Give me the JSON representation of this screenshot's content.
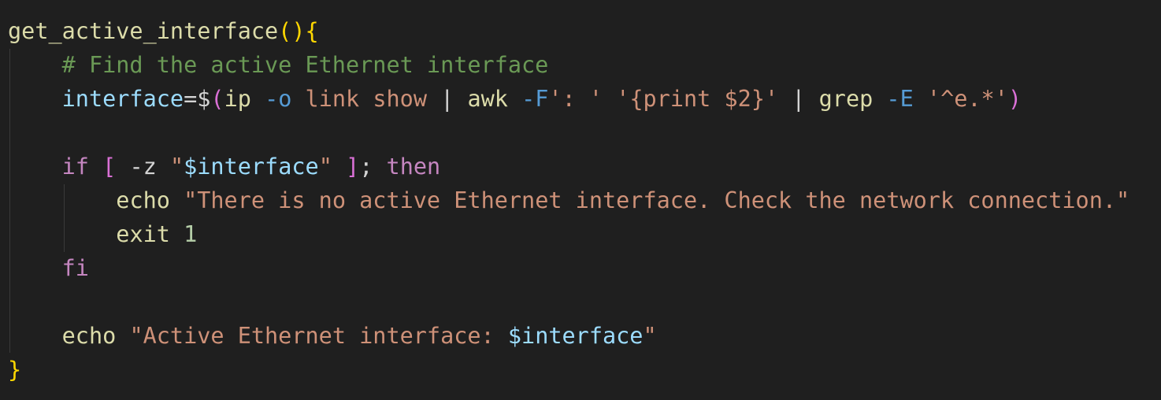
{
  "colors": {
    "background": "#1f1f1f",
    "function_name": "#dcdcaa",
    "bracket_gold": "#ffd700",
    "bracket_purple": "#da70d6",
    "comment": "#6a9955",
    "variable": "#9cdcfe",
    "keyword": "#c586c0",
    "string": "#ce9178",
    "option": "#569cd6",
    "number": "#b5cea8",
    "default": "#d4d4d4"
  },
  "code": {
    "lines": [
      [
        {
          "text": "get_active_interface",
          "color": "#dcdcaa"
        },
        {
          "text": "()",
          "color": "#ffd700"
        },
        {
          "text": "{",
          "color": "#ffd700"
        }
      ],
      [
        {
          "text": "    "
        },
        {
          "text": "# Find the active Ethernet interface",
          "color": "#6a9955"
        }
      ],
      [
        {
          "text": "    "
        },
        {
          "text": "interface",
          "color": "#9cdcfe"
        },
        {
          "text": "=$",
          "color": "#d4d4d4"
        },
        {
          "text": "(",
          "color": "#da70d6"
        },
        {
          "text": "ip ",
          "color": "#dcdcaa"
        },
        {
          "text": "-o",
          "color": "#569cd6"
        },
        {
          "text": " link show ",
          "color": "#ce9178"
        },
        {
          "text": "| ",
          "color": "#d4d4d4"
        },
        {
          "text": "awk ",
          "color": "#dcdcaa"
        },
        {
          "text": "-F",
          "color": "#569cd6"
        },
        {
          "text": "': ' '{print $2}' ",
          "color": "#ce9178"
        },
        {
          "text": "| ",
          "color": "#d4d4d4"
        },
        {
          "text": "grep ",
          "color": "#dcdcaa"
        },
        {
          "text": "-E",
          "color": "#569cd6"
        },
        {
          "text": " '^e.*'",
          "color": "#ce9178"
        },
        {
          "text": ")",
          "color": "#da70d6"
        }
      ],
      [],
      [
        {
          "text": "    "
        },
        {
          "text": "if ",
          "color": "#c586c0"
        },
        {
          "text": "[ ",
          "color": "#da70d6"
        },
        {
          "text": "-z ",
          "color": "#d4d4d4"
        },
        {
          "text": "\"",
          "color": "#ce9178"
        },
        {
          "text": "$interface",
          "color": "#9cdcfe"
        },
        {
          "text": "\" ",
          "color": "#ce9178"
        },
        {
          "text": "]",
          "color": "#da70d6"
        },
        {
          "text": "; ",
          "color": "#d4d4d4"
        },
        {
          "text": "then",
          "color": "#c586c0"
        }
      ],
      [
        {
          "text": "        "
        },
        {
          "text": "echo ",
          "color": "#dcdcaa"
        },
        {
          "text": "\"There is no active Ethernet interface. Check the network connection.\"",
          "color": "#ce9178"
        }
      ],
      [
        {
          "text": "        "
        },
        {
          "text": "exit ",
          "color": "#dcdcaa"
        },
        {
          "text": "1",
          "color": "#b5cea8"
        }
      ],
      [
        {
          "text": "    "
        },
        {
          "text": "fi",
          "color": "#c586c0"
        }
      ],
      [],
      [
        {
          "text": "    "
        },
        {
          "text": "echo ",
          "color": "#dcdcaa"
        },
        {
          "text": "\"Active Ethernet interface: ",
          "color": "#ce9178"
        },
        {
          "text": "$interface",
          "color": "#9cdcfe"
        },
        {
          "text": "\"",
          "color": "#ce9178"
        }
      ],
      [
        {
          "text": "}",
          "color": "#ffd700"
        }
      ]
    ]
  }
}
